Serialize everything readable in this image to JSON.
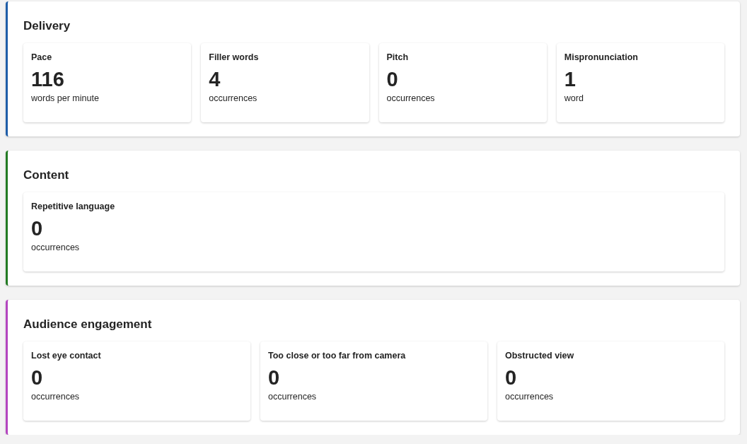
{
  "sections": [
    {
      "title": "Delivery",
      "color": "#1f5ea8",
      "metrics": [
        {
          "label": "Pace",
          "value": "116",
          "unit": "words per minute"
        },
        {
          "label": "Filler words",
          "value": "4",
          "unit": "occurrences"
        },
        {
          "label": "Pitch",
          "value": "0",
          "unit": "occurrences"
        },
        {
          "label": "Mispronunciation",
          "value": "1",
          "unit": "word"
        }
      ]
    },
    {
      "title": "Content",
      "color": "#237b23",
      "metrics": [
        {
          "label": "Repetitive language",
          "value": "0",
          "unit": "occurrences"
        }
      ]
    },
    {
      "title": "Audience engagement",
      "color": "#b446c0",
      "metrics": [
        {
          "label": "Lost eye contact",
          "value": "0",
          "unit": "occurrences"
        },
        {
          "label": "Too close or too far from camera",
          "value": "0",
          "unit": "occurrences"
        },
        {
          "label": "Obstructed view",
          "value": "0",
          "unit": "occurrences"
        }
      ]
    }
  ]
}
